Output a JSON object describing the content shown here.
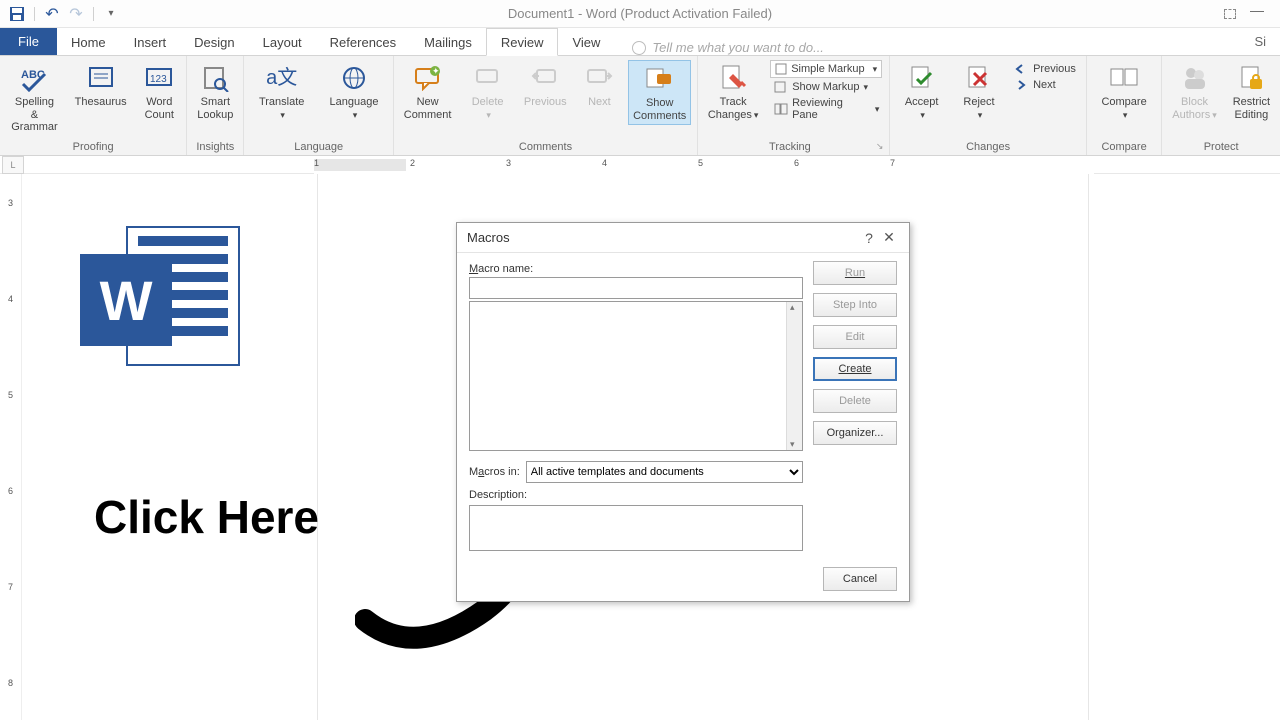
{
  "title": "Document1 - Word (Product Activation Failed)",
  "tabs": {
    "file": "File",
    "home": "Home",
    "insert": "Insert",
    "design": "Design",
    "layout": "Layout",
    "references": "References",
    "mailings": "Mailings",
    "review": "Review",
    "view": "View"
  },
  "tellme": "Tell me what you want to do...",
  "ribbon": {
    "proofing": {
      "spelling": "Spelling &\nGrammar",
      "thesaurus": "Thesaurus",
      "wordcount": "Word\nCount",
      "label": "Proofing"
    },
    "insights": {
      "smart": "Smart\nLookup",
      "label": "Insights"
    },
    "language": {
      "translate": "Translate",
      "language": "Language",
      "label": "Language"
    },
    "comments": {
      "new": "New\nComment",
      "delete": "Delete",
      "previous": "Previous",
      "next": "Next",
      "show": "Show\nComments",
      "label": "Comments"
    },
    "tracking": {
      "track": "Track\nChanges",
      "simple": "Simple Markup",
      "showmarkup": "Show Markup",
      "pane": "Reviewing Pane",
      "label": "Tracking"
    },
    "changes": {
      "accept": "Accept",
      "reject": "Reject",
      "previous": "Previous",
      "next": "Next",
      "label": "Changes"
    },
    "compare": {
      "compare": "Compare",
      "label": "Compare"
    },
    "protect": {
      "block": "Block\nAuthors",
      "restrict": "Restrict\nEditing",
      "label": "Protect"
    }
  },
  "ruler": {
    "1": "1",
    "2": "2",
    "3": "3",
    "4": "4",
    "5": "5",
    "6": "6",
    "7": "7"
  },
  "vruler": {
    "3": "3",
    "4": "4",
    "5": "5",
    "6": "6",
    "7": "7",
    "8": "8"
  },
  "logo_letter": "W",
  "annotation": "Click Here",
  "dialog": {
    "title": "Macros",
    "macro_name_label": "Macro name:",
    "macro_name_value": "",
    "macros_in_label": "Macros in:",
    "macros_in_value": "All active templates and documents",
    "description_label": "Description:",
    "buttons": {
      "run": "Run",
      "step": "Step Into",
      "edit": "Edit",
      "create": "Create",
      "delete": "Delete",
      "organizer": "Organizer...",
      "cancel": "Cancel"
    }
  }
}
